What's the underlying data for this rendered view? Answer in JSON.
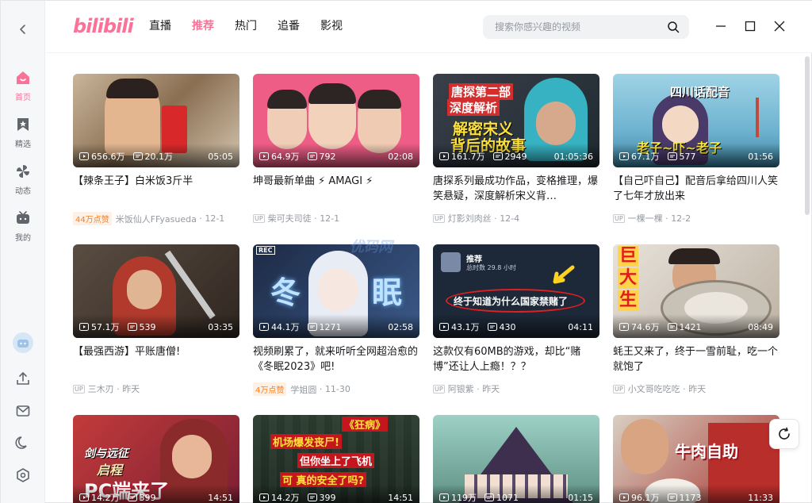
{
  "app": {
    "logo": "bilibili"
  },
  "header": {
    "nav": [
      "直播",
      "推荐",
      "热门",
      "追番",
      "影视"
    ],
    "active_nav": 1,
    "search_placeholder": "搜索你感兴趣的视频"
  },
  "sidebar": {
    "items": [
      {
        "label": "首页",
        "icon": "home-icon",
        "active": true
      },
      {
        "label": "精选",
        "icon": "bookmark-icon",
        "active": false
      },
      {
        "label": "动态",
        "icon": "pinwheel-icon",
        "active": false
      },
      {
        "label": "我的",
        "icon": "tv-icon",
        "active": false
      }
    ]
  },
  "colors": {
    "accent": "#fb7299",
    "hot": "#ff7f24"
  },
  "watermark": "优码网",
  "videos": [
    {
      "views": "656.6万",
      "danmaku": "20.1万",
      "duration": "05:05",
      "title": "【辣条王子】白米饭3斤半",
      "hot": "44万点赞",
      "author": "米饭仙人FFyasueda",
      "date": "12-1"
    },
    {
      "views": "64.9万",
      "danmaku": "792",
      "duration": "02:08",
      "title": "坤哥最新单曲 ⚡ AMAGI ⚡",
      "hot": "",
      "author": "柴可夫司徒",
      "date": "12-1"
    },
    {
      "views": "161.7万",
      "danmaku": "2949",
      "duration": "01:05:36",
      "title": "唐探系列最成功作品，变格推理，爆笑悬疑，深度解析宋义背…",
      "hot": "",
      "author": "灯影刘肉丝",
      "date": "12-4",
      "overlay": [
        "唐探第二部",
        "深度解析",
        "解密宋义",
        "背后的故事"
      ]
    },
    {
      "views": "67.1万",
      "danmaku": "577",
      "duration": "01:56",
      "title": "【自己吓自己】配音后拿给四川人笑了七年才放出来",
      "hot": "",
      "author": "一棵一棵",
      "date": "12-2",
      "overlay": [
        "四川话配音",
        "老子~吓~老子"
      ]
    },
    {
      "views": "57.1万",
      "danmaku": "539",
      "duration": "03:35",
      "title": "【最强西游】平账唐僧!",
      "hot": "",
      "author": "三木刃",
      "date": "昨天"
    },
    {
      "views": "44.1万",
      "danmaku": "1271",
      "duration": "02:58",
      "title": "视频刷累了，就来听听全网超治愈的《冬眠2023》吧!",
      "hot": "4万点赞",
      "author": "学姐圆",
      "date": "11-30",
      "overlay": [
        "冬",
        "眠",
        "REC"
      ]
    },
    {
      "views": "43.1万",
      "danmaku": "430",
      "duration": "04:11",
      "title": "这款仅有60MB的游戏，却比“赌博”还让人上瘾！？？",
      "hot": "",
      "author": "阿银紫",
      "date": "昨天",
      "overlay": [
        "推荐",
        "总时数 29.8 小时",
        "终于知道为什么国家禁赌了"
      ]
    },
    {
      "views": "74.6万",
      "danmaku": "1421",
      "duration": "08:49",
      "title": "蚝王又来了，终于一雪前耻，吃一个就饱了",
      "hot": "",
      "author": "小文哥吃吃吃",
      "date": "昨天",
      "overlay": [
        "巨",
        "大",
        "生"
      ]
    },
    {
      "views": "14.2万",
      "danmaku": "399",
      "duration": "14:51",
      "title": "",
      "hot": "",
      "author": "",
      "date": "",
      "overlay": [
        "剑与远征",
        "启程",
        "PC端来了"
      ]
    },
    {
      "views": "14.2万",
      "danmaku": "399",
      "duration": "14:51",
      "title": "",
      "hot": "",
      "author": "",
      "date": "",
      "overlay": [
        "《狂病》",
        "机场爆发丧尸!",
        "但你坐上了飞机",
        "可 真的安全了吗?"
      ]
    },
    {
      "views": "119万",
      "danmaku": "1071",
      "duration": "01:15",
      "title": "",
      "hot": "",
      "author": "",
      "date": ""
    },
    {
      "views": "96.1万",
      "danmaku": "1173",
      "duration": "11:33",
      "title": "",
      "hot": "",
      "author": "",
      "date": "",
      "overlay": [
        "牛肉自助"
      ]
    }
  ]
}
